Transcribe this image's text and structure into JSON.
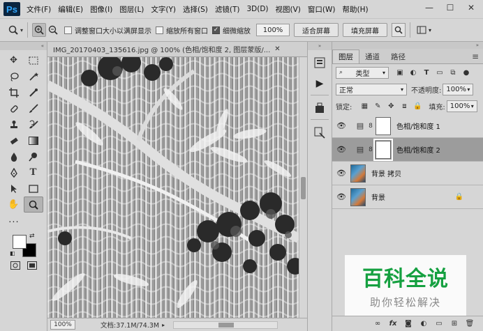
{
  "app": {
    "logo": "Ps"
  },
  "menu": [
    "文件(F)",
    "编辑(E)",
    "图像(I)",
    "图层(L)",
    "文字(Y)",
    "选择(S)",
    "滤镜(T)",
    "3D(D)",
    "视图(V)",
    "窗口(W)",
    "帮助(H)"
  ],
  "window_controls": {
    "minimize": "—",
    "maximize": "☐",
    "close": "✕"
  },
  "options": {
    "resize_windows": "调整窗口大小以满屏显示",
    "zoom_all_windows": "缩放所有窗口",
    "scrubby_zoom": "细微缩放",
    "zoom_value": "100%",
    "fit_screen": "适合屏幕",
    "fill_screen": "填充屏幕"
  },
  "document": {
    "tab_title": "IMG_20170403_135616.jpg @ 100% (色相/饱和度 2, 图层蒙版/...",
    "close": "✕",
    "zoom": "100%",
    "doc_size": "文档:37.1M/74.3M"
  },
  "layers_panel": {
    "tabs": [
      "图层",
      "通道",
      "路径"
    ],
    "filter_kind": "类型",
    "blend_mode": "正常",
    "opacity_label": "不透明度:",
    "opacity": "100%",
    "lock_label": "锁定:",
    "fill_label": "填充:",
    "fill": "100%",
    "layers": [
      {
        "name": "色相/饱和度 1",
        "kind": "adjustment",
        "active": false
      },
      {
        "name": "色相/饱和度 2",
        "kind": "adjustment",
        "active": true
      },
      {
        "name": "背景 拷贝",
        "kind": "image",
        "active": false
      },
      {
        "name": "背景",
        "kind": "image",
        "active": false,
        "locked": true
      }
    ],
    "footer": [
      "fx"
    ]
  },
  "watermark": {
    "title": "百科全说",
    "subtitle": "助你轻松解决",
    "color": "#15a040"
  },
  "colors": {
    "foreground": "#ffffff",
    "background": "#000000"
  }
}
